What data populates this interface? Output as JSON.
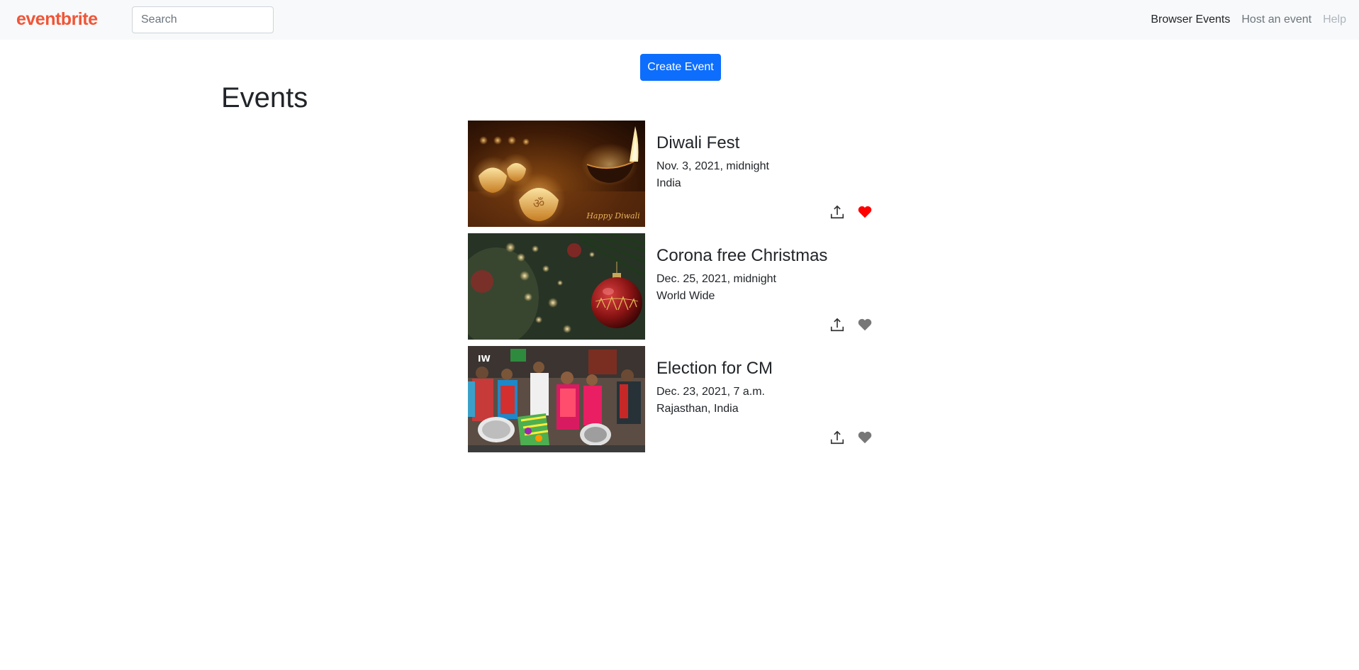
{
  "navbar": {
    "brand": "eventbrite",
    "search_placeholder": "Search",
    "links": [
      {
        "label": "Browser Events"
      },
      {
        "label": "Host an event"
      },
      {
        "label": "Help"
      }
    ]
  },
  "create_button_label": "Create Event",
  "page_title": "Events",
  "events": [
    {
      "title": "Diwali Fest",
      "date": "Nov. 3, 2021, midnight",
      "location": "India",
      "image_text": "Happy Diwali",
      "liked": true
    },
    {
      "title": "Corona free Christmas",
      "date": "Dec. 25, 2021, midnight",
      "location": "World Wide",
      "liked": false
    },
    {
      "title": "Election for CM",
      "date": "Dec. 23, 2021, 7 a.m.",
      "location": "Rajasthan, India",
      "image_text": "IW",
      "liked": false
    }
  ],
  "icons": {
    "share": "share-icon",
    "heart": "heart-icon"
  },
  "colors": {
    "brand": "#f05537",
    "primary": "#0d6efd",
    "liked": "#ff0000",
    "unliked": "#777777",
    "navbar_bg": "#f8f9fa"
  }
}
